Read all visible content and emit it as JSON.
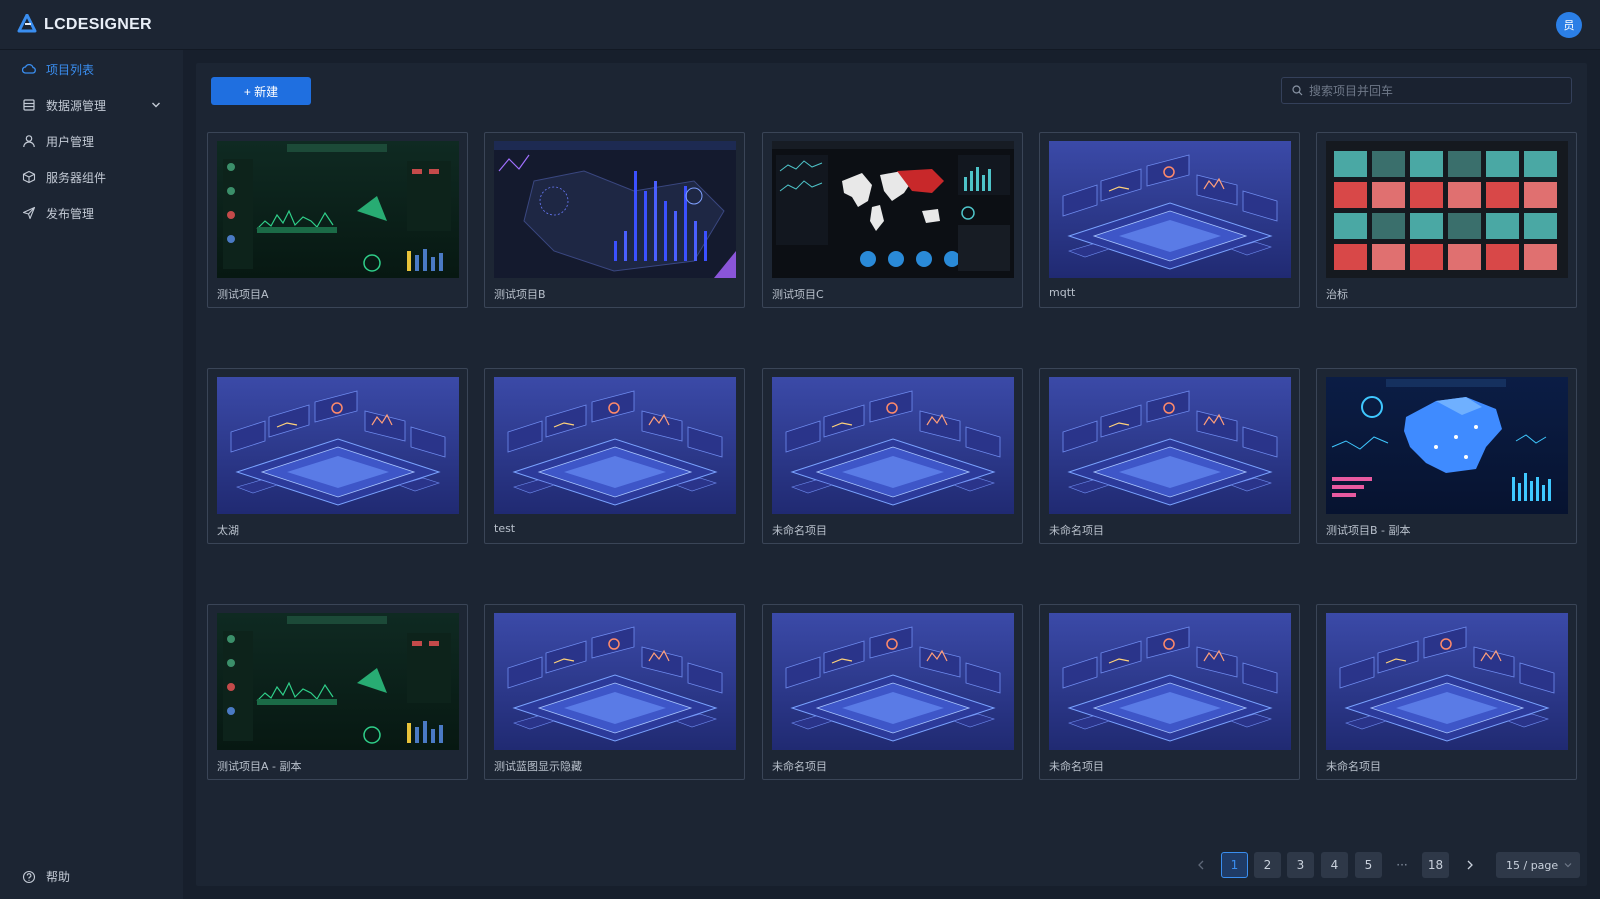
{
  "app": {
    "logo_text": "LCDESIGNER",
    "avatar_text": "员"
  },
  "sidebar": {
    "items": [
      {
        "label": "项目列表",
        "icon": "cloud-icon",
        "active": true
      },
      {
        "label": "数据源管理",
        "icon": "database-icon",
        "expandable": true
      },
      {
        "label": "用户管理",
        "icon": "user-icon"
      },
      {
        "label": "服务器组件",
        "icon": "cube-icon"
      },
      {
        "label": "发布管理",
        "icon": "send-icon"
      }
    ],
    "help_label": "帮助"
  },
  "toolbar": {
    "new_label": "+ 新建",
    "search_placeholder": "搜索项目并回车"
  },
  "projects": [
    {
      "title": "测试项目A",
      "thumb": "green-dashboard"
    },
    {
      "title": "测试项目B",
      "thumb": "bar-map-dashboard"
    },
    {
      "title": "测试项目C",
      "thumb": "world-map-dashboard"
    },
    {
      "title": "mqtt",
      "thumb": "isometric-default"
    },
    {
      "title": "治标",
      "thumb": "tile-grid"
    },
    {
      "title": "太湖",
      "thumb": "isometric-default"
    },
    {
      "title": "test",
      "thumb": "isometric-default"
    },
    {
      "title": "未命名项目",
      "thumb": "isometric-default"
    },
    {
      "title": "未命名项目",
      "thumb": "isometric-default"
    },
    {
      "title": "测试项目B - 副本",
      "thumb": "china-map-dashboard"
    },
    {
      "title": "测试项目A - 副本",
      "thumb": "green-dashboard"
    },
    {
      "title": "测试蓝图显示隐藏",
      "thumb": "isometric-default"
    },
    {
      "title": "未命名项目",
      "thumb": "isometric-default"
    },
    {
      "title": "未命名项目",
      "thumb": "isometric-default"
    },
    {
      "title": "未命名项目",
      "thumb": "isometric-default"
    }
  ],
  "pagination": {
    "pages": [
      "1",
      "2",
      "3",
      "4",
      "5"
    ],
    "current": "1",
    "ellipsis": "···",
    "last": "18",
    "page_size": "15 / page"
  },
  "colors": {
    "accent": "#1f6fe0",
    "active_text": "#3a8ef0",
    "background": "#171f2c",
    "panel": "#1c2533"
  }
}
